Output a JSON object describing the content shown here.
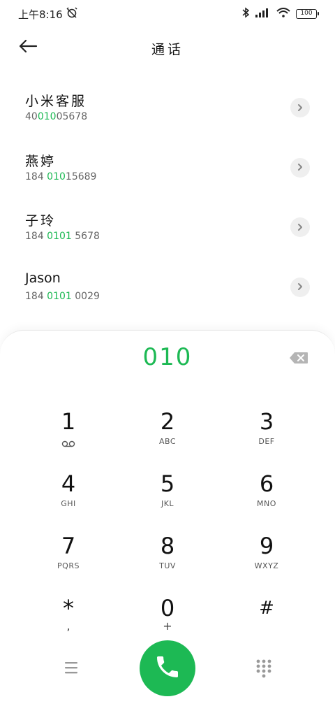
{
  "status_bar": {
    "time": "上午8:16",
    "battery": "100"
  },
  "header": {
    "title": "通话"
  },
  "contacts": [
    {
      "name": "小米客服",
      "number_prefix": "40",
      "number_match": "010",
      "number_suffix": "05678"
    },
    {
      "name": "燕婷",
      "number_prefix": "184 ",
      "number_match": "010",
      "number_suffix": "15689"
    },
    {
      "name": "子玲",
      "number_prefix": "184 ",
      "number_match": "0101",
      "number_suffix": " 5678"
    },
    {
      "name": "Jason",
      "number_prefix": "184 ",
      "number_match": "0101",
      "number_suffix": " 0029"
    }
  ],
  "dialpad": {
    "input_value": "010",
    "keys": [
      {
        "digit": "1",
        "sub": "voicemail"
      },
      {
        "digit": "2",
        "sub": "ABC"
      },
      {
        "digit": "3",
        "sub": "DEF"
      },
      {
        "digit": "4",
        "sub": "GHI"
      },
      {
        "digit": "5",
        "sub": "JKL"
      },
      {
        "digit": "6",
        "sub": "MNO"
      },
      {
        "digit": "7",
        "sub": "PQRS"
      },
      {
        "digit": "8",
        "sub": "TUV"
      },
      {
        "digit": "9",
        "sub": "WXYZ"
      },
      {
        "digit": "*",
        "sub": ","
      },
      {
        "digit": "0",
        "sub": "+"
      },
      {
        "digit": "#",
        "sub": ""
      }
    ]
  },
  "colors": {
    "accent": "#1db954",
    "chevron_bg": "#efefef"
  }
}
